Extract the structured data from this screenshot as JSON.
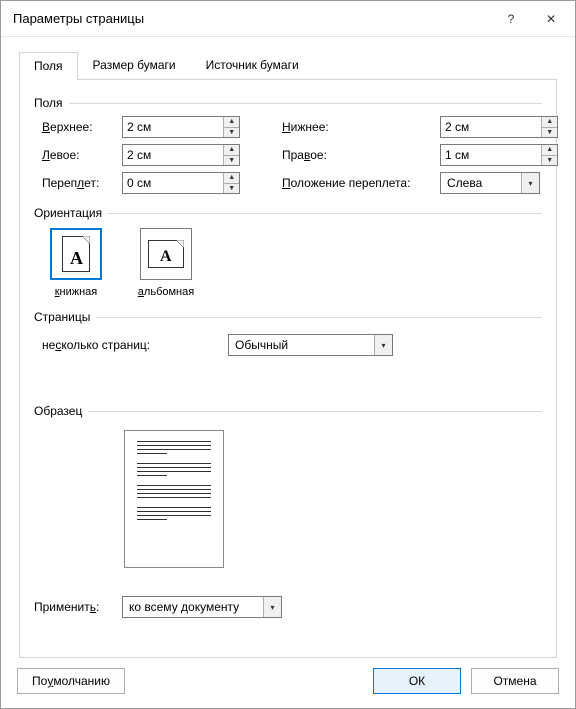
{
  "window": {
    "title": "Параметры страницы",
    "help": "?",
    "close": "✕"
  },
  "tabs": {
    "t0": "Поля",
    "t1": "Размер бумаги",
    "t2": "Источник бумаги"
  },
  "margins": {
    "section": "Поля",
    "top_label": "Верхнее:",
    "top_u": "В",
    "top_rest": "ерхнее:",
    "top_val": "2 см",
    "bottom_u": "Н",
    "bottom_rest": "ижнее:",
    "bottom_val": "2 см",
    "left_u": "Л",
    "left_rest": "евое:",
    "left_val": "2 см",
    "right_label": "Правое:",
    "right_u": "в",
    "right_pre": "Пра",
    "right_post": "ое:",
    "right_val": "1 см",
    "gutter_u": "л",
    "gutter_pre": "Переп",
    "gutter_post": "ет:",
    "gutter_val": "0 см",
    "gutterpos_u": "П",
    "gutterpos_rest": "оложение переплета:",
    "gutterpos_val": "Слева"
  },
  "orientation": {
    "section": "Ориентация",
    "portrait_u": "к",
    "portrait_rest": "нижная",
    "landscape_u": "а",
    "landscape_rest": "льбомная"
  },
  "pages": {
    "section": "Страницы",
    "multi_u": "с",
    "multi_pre": "не",
    "multi_post": "колько страниц:",
    "multi_val": "Обычный"
  },
  "preview": {
    "section": "Образец"
  },
  "apply": {
    "label_pre": "Применит",
    "label_u": "ь",
    "label_post": ":",
    "val": "ко всему документу"
  },
  "footer": {
    "default_pre": "По ",
    "default_u": "у",
    "default_post": "молчанию",
    "ok": "ОК",
    "cancel": "Отмена"
  }
}
